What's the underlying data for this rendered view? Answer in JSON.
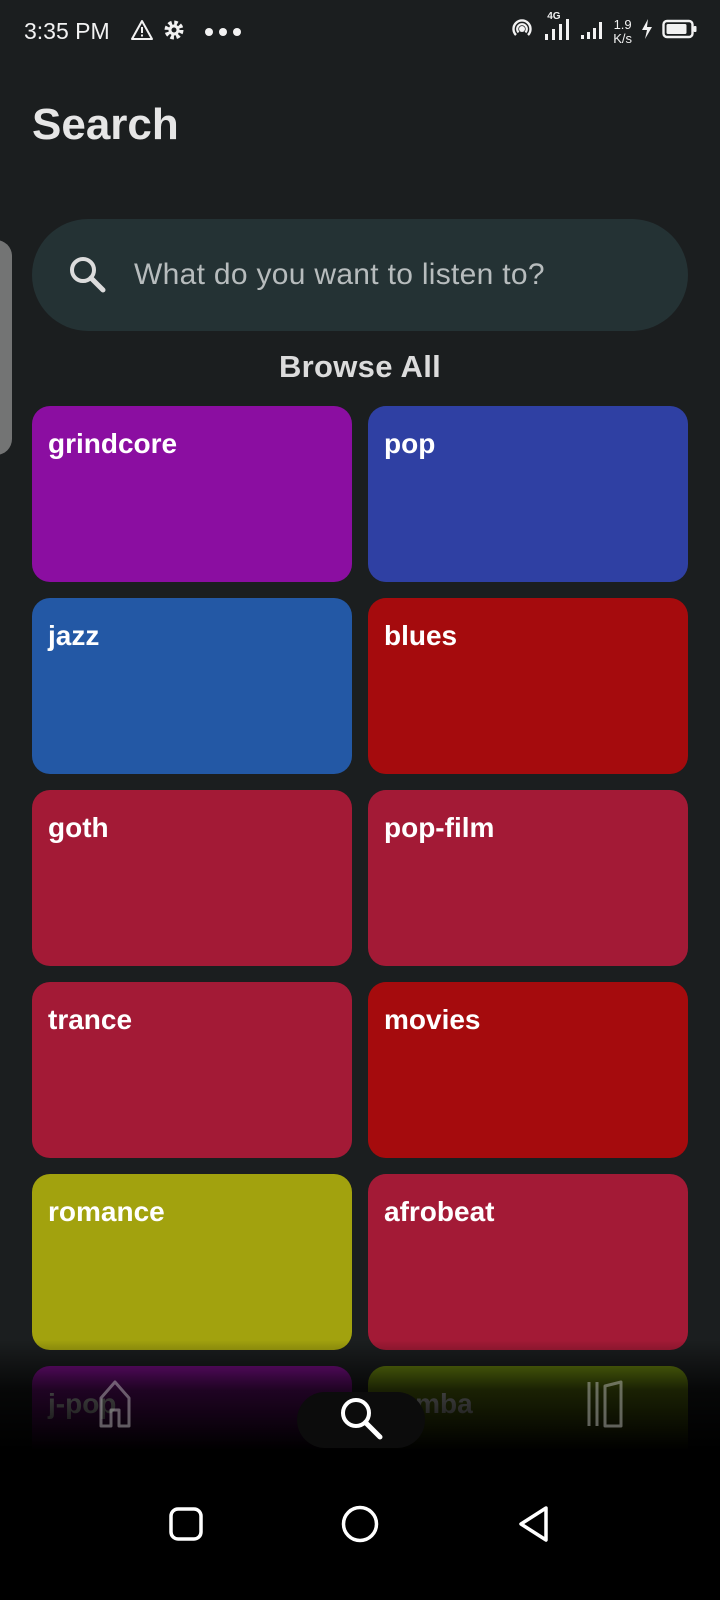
{
  "status_bar": {
    "time": "3:35 PM",
    "net_speed_value": "1.9",
    "net_speed_unit": "K/s",
    "network_type": "4G",
    "icons": [
      "warning-icon",
      "gear-icon",
      "more-dots-icon",
      "hotspot-icon",
      "signal-4g-icon",
      "signal-icon",
      "charging-icon",
      "battery-icon"
    ]
  },
  "header": {
    "title": "Search"
  },
  "search": {
    "placeholder": "What do you want to listen to?",
    "icon": "search-icon"
  },
  "browse": {
    "title": "Browse All",
    "categories": [
      {
        "label": "grindcore",
        "color": "#8b0ea1"
      },
      {
        "label": "pop",
        "color": "#2f40a3"
      },
      {
        "label": "jazz",
        "color": "#2358a5"
      },
      {
        "label": "blues",
        "color": "#a50b0d"
      },
      {
        "label": "goth",
        "color": "#a31a36"
      },
      {
        "label": "pop-film",
        "color": "#a31a36"
      },
      {
        "label": "trance",
        "color": "#a31a36"
      },
      {
        "label": "movies",
        "color": "#a50b0d"
      },
      {
        "label": "romance",
        "color": "#a2a20e"
      },
      {
        "label": "afrobeat",
        "color": "#a31a36"
      },
      {
        "label": "j-pop",
        "color": "#7d0e8c"
      },
      {
        "label": "samba",
        "color": "#6a850e"
      }
    ]
  },
  "bottom_nav": {
    "items": [
      {
        "name": "home",
        "icon": "home-icon",
        "active": false
      },
      {
        "name": "search",
        "icon": "search-icon",
        "active": true
      },
      {
        "name": "library",
        "icon": "library-icon",
        "active": false
      }
    ]
  },
  "system_nav": {
    "icons": [
      "recents-icon",
      "home-circle-icon",
      "back-icon"
    ]
  }
}
